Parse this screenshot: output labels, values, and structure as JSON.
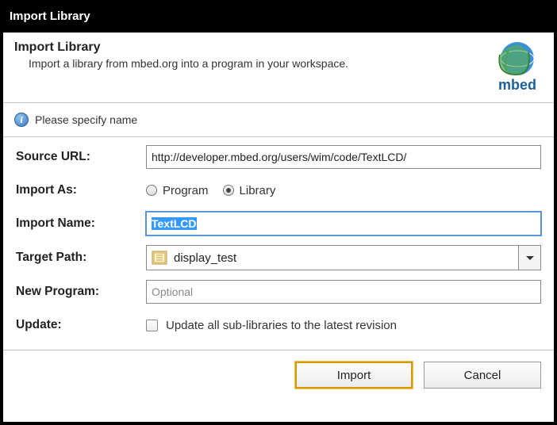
{
  "titlebar": "Import Library",
  "header": {
    "title": "Import Library",
    "description": "Import a library from mbed.org into a program in your workspace.",
    "logo_text": "mbed"
  },
  "info": {
    "message": "Please specify name"
  },
  "form": {
    "source_url": {
      "label": "Source URL:",
      "value": "http://developer.mbed.org/users/wim/code/TextLCD/"
    },
    "import_as": {
      "label": "Import As:",
      "options": {
        "program": "Program",
        "library": "Library"
      },
      "selected": "library"
    },
    "import_name": {
      "label": "Import Name:",
      "value": "TextLCD"
    },
    "target_path": {
      "label": "Target Path:",
      "value": "display_test"
    },
    "new_program": {
      "label": "New Program:",
      "placeholder": "Optional",
      "value": ""
    },
    "update": {
      "label": "Update:",
      "checkbox_label": "Update all sub-libraries to the latest revision",
      "checked": false
    }
  },
  "footer": {
    "import": "Import",
    "cancel": "Cancel"
  }
}
